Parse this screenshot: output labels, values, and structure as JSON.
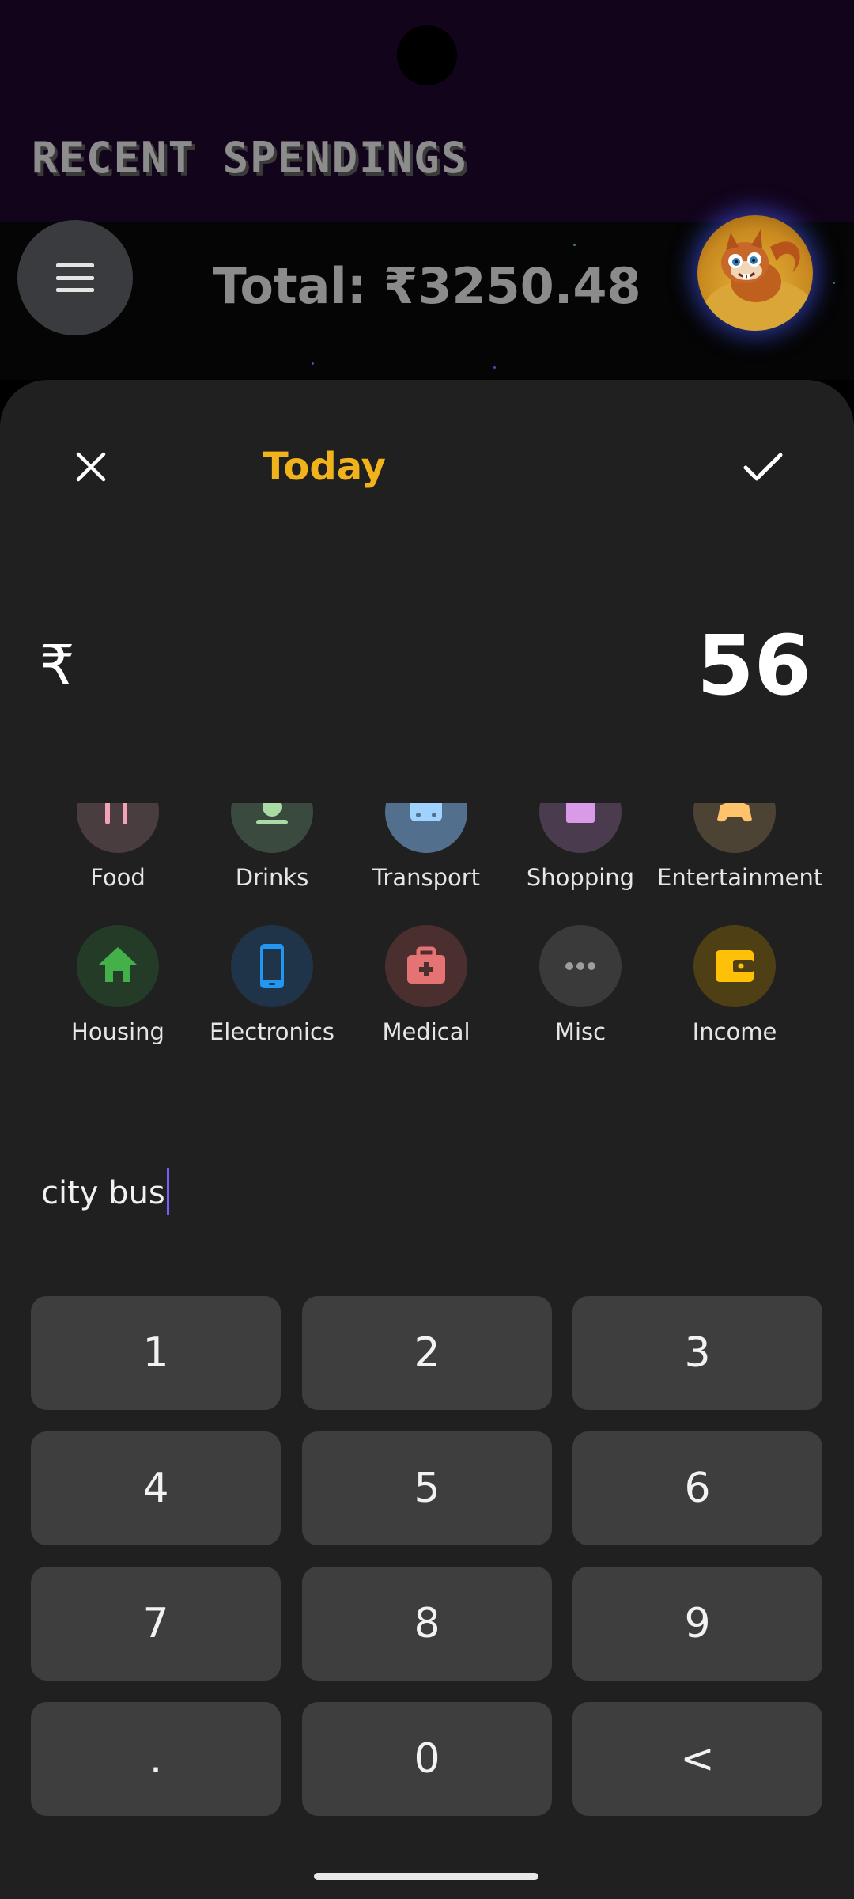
{
  "header": {
    "app_title": "RECENT SPENDINGS",
    "total_text": "Total: ₹3250.48"
  },
  "icons": {
    "menu": "hamburger-menu-icon",
    "avatar": "squirrel-avatar",
    "close": "close-icon",
    "confirm": "check-icon"
  },
  "entry": {
    "date_label": "Today",
    "currency_symbol": "₹",
    "amount": "56",
    "note": "city bus"
  },
  "categories": [
    {
      "label": "Food",
      "icon": "fork-knife-icon",
      "bg": "#4a3d40",
      "fg": "#f2a3b5"
    },
    {
      "label": "Drinks",
      "icon": "drink-icon",
      "bg": "#3b4a3f",
      "fg": "#a9dca3"
    },
    {
      "label": "Transport",
      "icon": "bus-icon",
      "bg": "#52708e",
      "fg": "#9fd2ff"
    },
    {
      "label": "Shopping",
      "icon": "shopping-bag-icon",
      "bg": "#4a3b4f",
      "fg": "#d99ae8"
    },
    {
      "label": "Entertainment",
      "icon": "gamepad-icon",
      "bg": "#4d4335",
      "fg": "#ffc36b"
    },
    {
      "label": "Housing",
      "icon": "house-icon",
      "bg": "#243c27",
      "fg": "#43b04a"
    },
    {
      "label": "Electronics",
      "icon": "smartphone-icon",
      "bg": "#1f3448",
      "fg": "#2196f3"
    },
    {
      "label": "Medical",
      "icon": "medical-kit-icon",
      "bg": "#4b2e2e",
      "fg": "#e57373"
    },
    {
      "label": "Misc",
      "icon": "more-horizontal-icon",
      "bg": "#3a3a3a",
      "fg": "#9e9e9e"
    },
    {
      "label": "Income",
      "icon": "wallet-icon",
      "bg": "#4f3f14",
      "fg": "#ffc107"
    }
  ],
  "keypad": [
    "1",
    "2",
    "3",
    "4",
    "5",
    "6",
    "7",
    "8",
    "9",
    ".",
    "0",
    "<"
  ],
  "colors": {
    "accent": "#f0b31b",
    "sheet_bg": "#202020",
    "key_bg": "#3e3e3e",
    "caret": "#7d5cff"
  }
}
